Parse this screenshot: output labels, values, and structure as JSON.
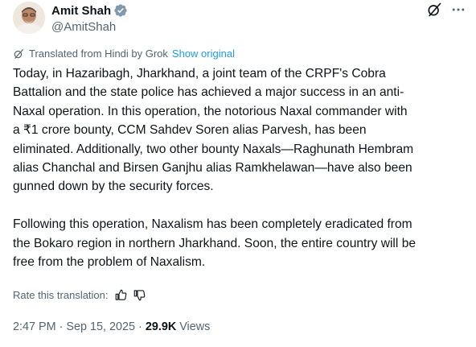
{
  "author": {
    "display_name": "Amit Shah",
    "handle": "@AmitShah",
    "verified": true,
    "avatar_icon": "profile-photo"
  },
  "header_icons": [
    "grok-icon",
    "more-icon"
  ],
  "translation": {
    "note": "Translated from Hindi by Grok",
    "show_original_label": "Show original"
  },
  "tweet": {
    "paragraph_1_lines": [
      "Today, in Hazaribagh, Jharkhand, a joint team of the CRPF's Cobra",
      "Battalion and the state police has achieved a major success in an anti-",
      "Naxal operation. In this operation, the notorious Naxal commander with",
      "a ₹1 crore bounty, CCM Sahdev Soren alias Parvesh, has been",
      "eliminated. Additionally, two other bounty Naxals—Raghunath Hembram",
      "alias Chanchal and Birsen Ganjhu alias Ramkhelawan—have also been",
      "gunned down by the security forces."
    ],
    "paragraph_2_lines": [
      "Following this operation, Naxalism has been completely eradicated from",
      "the Bokaro region in northern Jharkhand. Soon, the entire country will be",
      "free from the problem of Naxalism."
    ]
  },
  "rating": {
    "label": "Rate this translation:",
    "icons": [
      "thumbs-up-icon",
      "thumbs-down-icon"
    ]
  },
  "meta": {
    "time": "2:47 PM",
    "separator": "·",
    "date": "Sep 15, 2025",
    "views_count": "29.9K",
    "views_label": "Views"
  },
  "colors": {
    "text": "#0f1419",
    "secondary": "#536471",
    "link": "#1d9bf0",
    "verified_badge": "#829aab"
  }
}
